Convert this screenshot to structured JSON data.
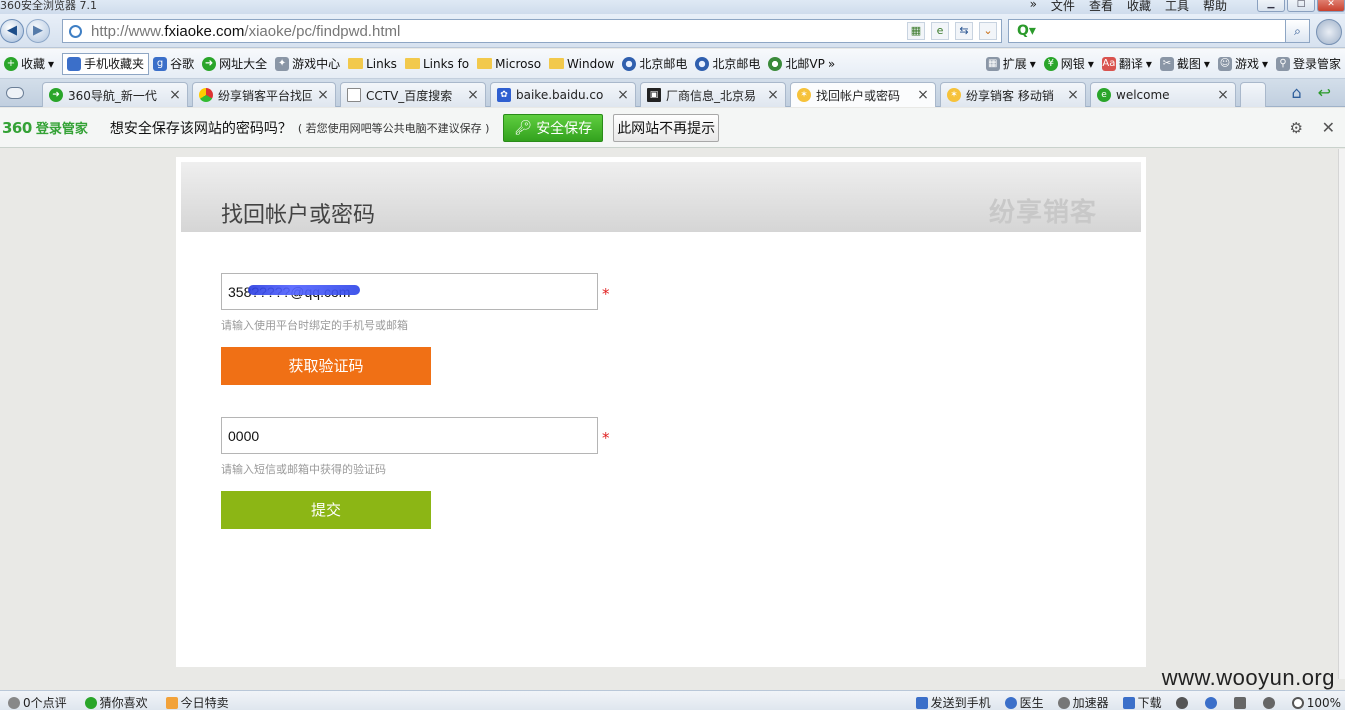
{
  "window": {
    "title": "360安全浏览器 7.1",
    "menus": [
      "»",
      "文件",
      "查看",
      "收藏",
      "工具",
      "帮助"
    ]
  },
  "address": {
    "url_prefix": "http://www.",
    "url_domain": "fxiaoke.com",
    "url_path": "/xiaoke/pc/findpwd.html"
  },
  "bookmarks": {
    "items": [
      {
        "label": "收藏",
        "icon": "star-add-icon"
      },
      {
        "label": "手机收藏夹",
        "icon": "phone-icon"
      },
      {
        "label": "谷歌",
        "icon": "google-icon"
      },
      {
        "label": "网址大全",
        "icon": "site-nav-icon"
      },
      {
        "label": "游戏中心",
        "icon": "gamepad-icon"
      },
      {
        "label": "Links",
        "icon": "folder-icon"
      },
      {
        "label": "Links fo",
        "icon": "folder-icon"
      },
      {
        "label": "Microso",
        "icon": "folder-icon"
      },
      {
        "label": "Window",
        "icon": "folder-icon"
      },
      {
        "label": "北京邮电",
        "icon": "ie-icon"
      },
      {
        "label": "北京邮电",
        "icon": "ie-icon"
      },
      {
        "label": "北邮VP",
        "icon": "ie-icon"
      }
    ],
    "more": "»",
    "right_items": [
      {
        "label": "扩展",
        "icon": "grid-icon"
      },
      {
        "label": "网银",
        "icon": "bank-icon"
      },
      {
        "label": "翻译",
        "icon": "translate-icon"
      },
      {
        "label": "截图",
        "icon": "scissors-icon"
      },
      {
        "label": "游戏",
        "icon": "game-icon"
      },
      {
        "label": "登录管家",
        "icon": "key-icon"
      }
    ]
  },
  "tabs": [
    {
      "title": "360导航_新一代",
      "icon": "360-icon"
    },
    {
      "title": "纷享销客平台找回",
      "icon": "chrome-icon"
    },
    {
      "title": "CCTV_百度搜索",
      "icon": "page-icon"
    },
    {
      "title": "baike.baidu.co",
      "icon": "baidu-paw-icon"
    },
    {
      "title": "厂商信息_北京易",
      "icon": "film-icon"
    },
    {
      "title": "找回帐户或密码",
      "icon": "bee-icon"
    },
    {
      "title": "纷享销客 移动销",
      "icon": "bee-icon"
    },
    {
      "title": "welcome",
      "icon": "ie-icon"
    }
  ],
  "password_bar": {
    "logo": "360",
    "logo_text": "登录管家",
    "message": "想安全保存该网站的密码吗？",
    "hint": "( 若您使用网吧等公共电脑不建议保存 )",
    "save_label": "安全保存",
    "never_label": "此网站不再提示"
  },
  "page": {
    "title": "找回帐户或密码",
    "brand": "纷享销客",
    "account_value": "358?????@qq.com",
    "account_help": "请输入使用平台时绑定的手机号或邮箱",
    "get_code_label": "获取验证码",
    "code_value": "0000",
    "code_help": "请输入短信或邮箱中获得的验证码",
    "submit_label": "提交",
    "required_mark": "*"
  },
  "status": {
    "left": [
      "0个点评",
      "猜你喜欢",
      "今日特卖"
    ],
    "right": [
      "发送到手机",
      "医生",
      "加速器",
      "下载",
      "100%"
    ]
  },
  "watermark": "www.wooyun.org"
}
